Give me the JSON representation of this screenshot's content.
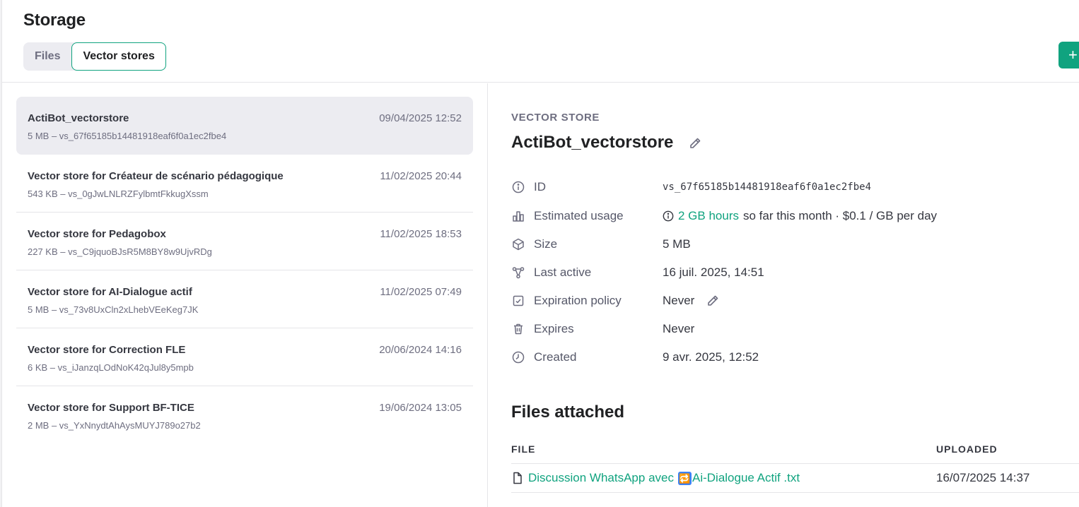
{
  "header": {
    "title": "Storage",
    "tabs": [
      {
        "label": "Files",
        "active": false
      },
      {
        "label": "Vector stores",
        "active": true
      }
    ],
    "create_button_icon": "plus-icon",
    "create_button_label": "+"
  },
  "stores": [
    {
      "name": "ActiBot_vectorstore",
      "meta": "5 MB – vs_67f65185b14481918eaf6f0a1ec2fbe4",
      "date": "09/04/2025 12:52",
      "selected": true
    },
    {
      "name": "Vector store for Créateur de scénario pédagogique",
      "meta": "543 KB – vs_0gJwLNLRZFylbmtFkkugXssm",
      "date": "11/02/2025 20:44"
    },
    {
      "name": "Vector store for Pedagobox",
      "meta": "227 KB – vs_C9jquoBJsR5M8BY8w9UjvRDg",
      "date": "11/02/2025 18:53"
    },
    {
      "name": "Vector store for AI-Dialogue actif",
      "meta": "5 MB – vs_73v8UxCln2xLhebVEeKeg7JK",
      "date": "11/02/2025 07:49"
    },
    {
      "name": "Vector store for Correction FLE",
      "meta": "6 KB – vs_iJanzqLOdNoK42qJul8y5mpb",
      "date": "20/06/2024 14:16"
    },
    {
      "name": "Vector store for Support BF-TICE",
      "meta": "2 MB – vs_YxNnydtAhAysMUYJ789o27b2",
      "date": "19/06/2024 13:05"
    }
  ],
  "detail": {
    "section_label": "VECTOR STORE",
    "title": "ActiBot_vectorstore",
    "properties": {
      "id": {
        "label": "ID",
        "value": "vs_67f65185b14481918eaf6f0a1ec2fbe4"
      },
      "usage": {
        "label": "Estimated usage",
        "link": "2 GB hours",
        "rest": "so far this month · $0.1 / GB per day"
      },
      "size": {
        "label": "Size",
        "value": "5 MB"
      },
      "last_active": {
        "label": "Last active",
        "value": "16 juil. 2025, 14:51"
      },
      "expiration": {
        "label": "Expiration policy",
        "value": "Never"
      },
      "expires": {
        "label": "Expires",
        "value": "Never"
      },
      "created": {
        "label": "Created",
        "value": "9 avr. 2025, 12:52"
      }
    },
    "files_title": "Files attached",
    "files_columns": {
      "file": "FILE",
      "uploaded": "UPLOADED"
    },
    "files": [
      {
        "name_prefix": "Discussion WhatsApp avec",
        "emoji": "🔁",
        "name_suffix": "Ai-Dialogue Actif .txt",
        "uploaded": "16/07/2025 14:37"
      }
    ]
  }
}
